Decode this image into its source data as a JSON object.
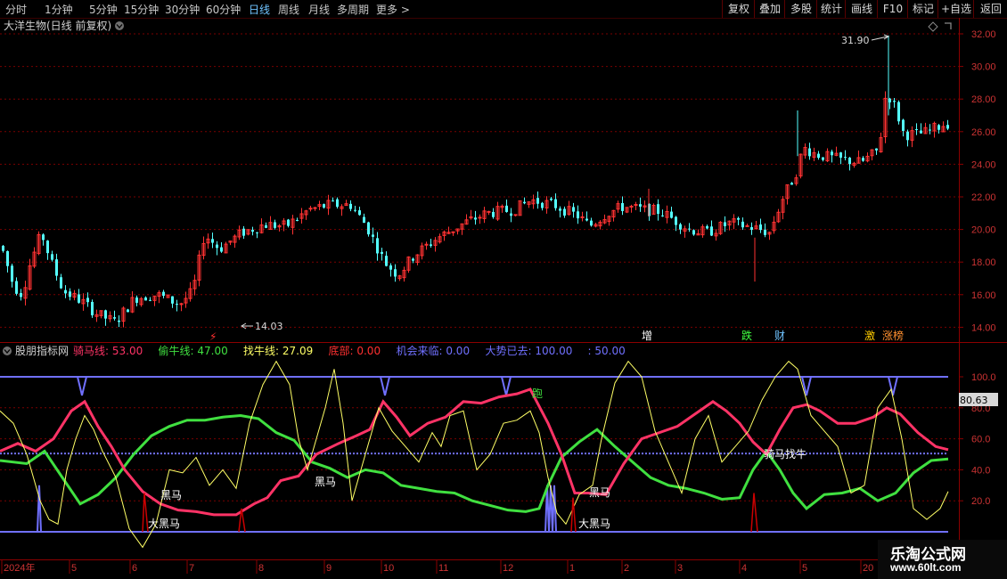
{
  "toolbar": {
    "periods": [
      "分时",
      "1分钟",
      "5分钟",
      "15分钟",
      "30分钟",
      "60分钟",
      "日线",
      "周线",
      "月线",
      "多周期",
      "更多 >"
    ],
    "active_period": "日线",
    "right_buttons": [
      "复权",
      "叠加",
      "多股",
      "统计",
      "画线",
      "F10",
      "标记",
      "+自选",
      "返回"
    ]
  },
  "stock": {
    "title": "大洋生物(日线 前复权)",
    "max_label": "31.90",
    "min_label": "14.03"
  },
  "price_axis": {
    "ticks": [
      "32.00",
      "30.00",
      "28.00",
      "26.00",
      "24.00",
      "22.00",
      "20.00",
      "18.00",
      "16.00",
      "14.00"
    ]
  },
  "event_tags": [
    {
      "text": "⚡",
      "color": "#ff3030"
    },
    {
      "text": "增",
      "color": "#ffffff"
    },
    {
      "text": "跌",
      "color": "#40ff40"
    },
    {
      "text": "财",
      "color": "#6fc3ff"
    },
    {
      "text": "激",
      "color": "#ffcc00"
    },
    {
      "text": "涨榜",
      "color": "#ff9030"
    }
  ],
  "indicator": {
    "name": "股朋指标网",
    "values": [
      {
        "label": "骑马线:",
        "value": "53.00",
        "color": "#ff3366"
      },
      {
        "label": "偷牛线:",
        "value": "47.00",
        "color": "#40e040"
      },
      {
        "label": "找牛线:",
        "value": "27.09",
        "color": "#ffff66"
      },
      {
        "label": "底部:",
        "value": "0.00",
        "color": "#ff3030"
      },
      {
        "label": "机会来临:",
        "value": "0.00",
        "color": "#7070ff"
      },
      {
        "label": "大势已去:",
        "value": "100.00",
        "color": "#7070ff"
      },
      {
        "label": ":",
        "value": "50.00",
        "color": "#7070ff"
      }
    ],
    "axis_ticks": [
      "100.0",
      "80.0",
      "60.0",
      "40.0",
      "20.0"
    ],
    "current_value": "80.63",
    "annotations": [
      "跑",
      "黑马",
      "黑马",
      "大黑马",
      "黑马",
      "大黑马",
      "骑马找牛"
    ]
  },
  "date_axis": {
    "labels": [
      "2024年",
      "5",
      "6",
      "7",
      "8",
      "9",
      "10",
      "11",
      "12",
      "1",
      "2",
      "3",
      "4",
      "5",
      "20"
    ]
  },
  "watermark": {
    "site": "乐淘公式网",
    "url": "www.60lt.com"
  },
  "colors": {
    "up": "#ff3232",
    "down": "#54ffff",
    "grid": "#8b0000",
    "ride_line": "#ff3366",
    "steal_line": "#40e040",
    "find_line": "#ffff66",
    "band_line": "#7070ff"
  }
}
